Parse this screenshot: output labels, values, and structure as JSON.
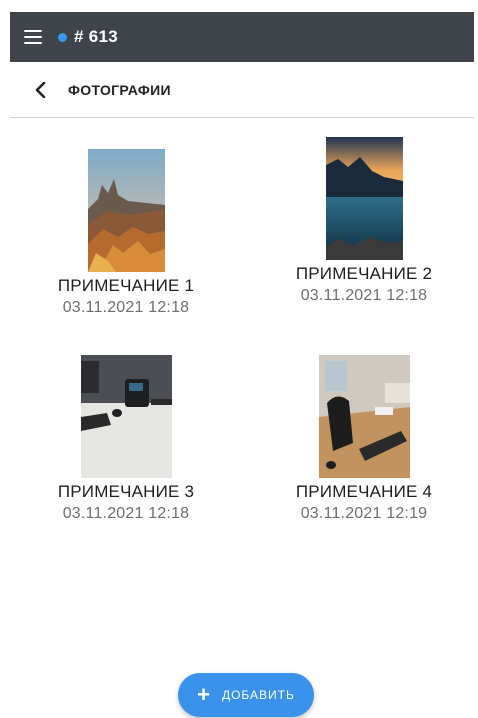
{
  "header": {
    "title": "# 613",
    "status_color": "#3b96f0",
    "menu_icon": "hamburger-menu-icon"
  },
  "subheader": {
    "back_icon": "chevron-left-icon",
    "title": "ФОТОГРАФИИ"
  },
  "photos": [
    {
      "title": "ПРИМЕЧАНИЕ 1",
      "date": "03.11.2021 12:18",
      "image": "desert-rock-formation-photo"
    },
    {
      "title": "ПРИМЕЧАНИЕ 2",
      "date": "03.11.2021 12:18",
      "image": "mountain-lake-sunset-photo"
    },
    {
      "title": "ПРИМЕЧАНИЕ 3",
      "date": "03.11.2021 12:18",
      "image": "office-desk-phone-photo"
    },
    {
      "title": "ПРИМЕЧАНИЕ 4",
      "date": "03.11.2021 12:19",
      "image": "office-desk-keyboard-photo"
    }
  ],
  "add_button": {
    "icon": "plus-icon",
    "label": "ДОБАВИТЬ",
    "color": "#3a92ea"
  }
}
